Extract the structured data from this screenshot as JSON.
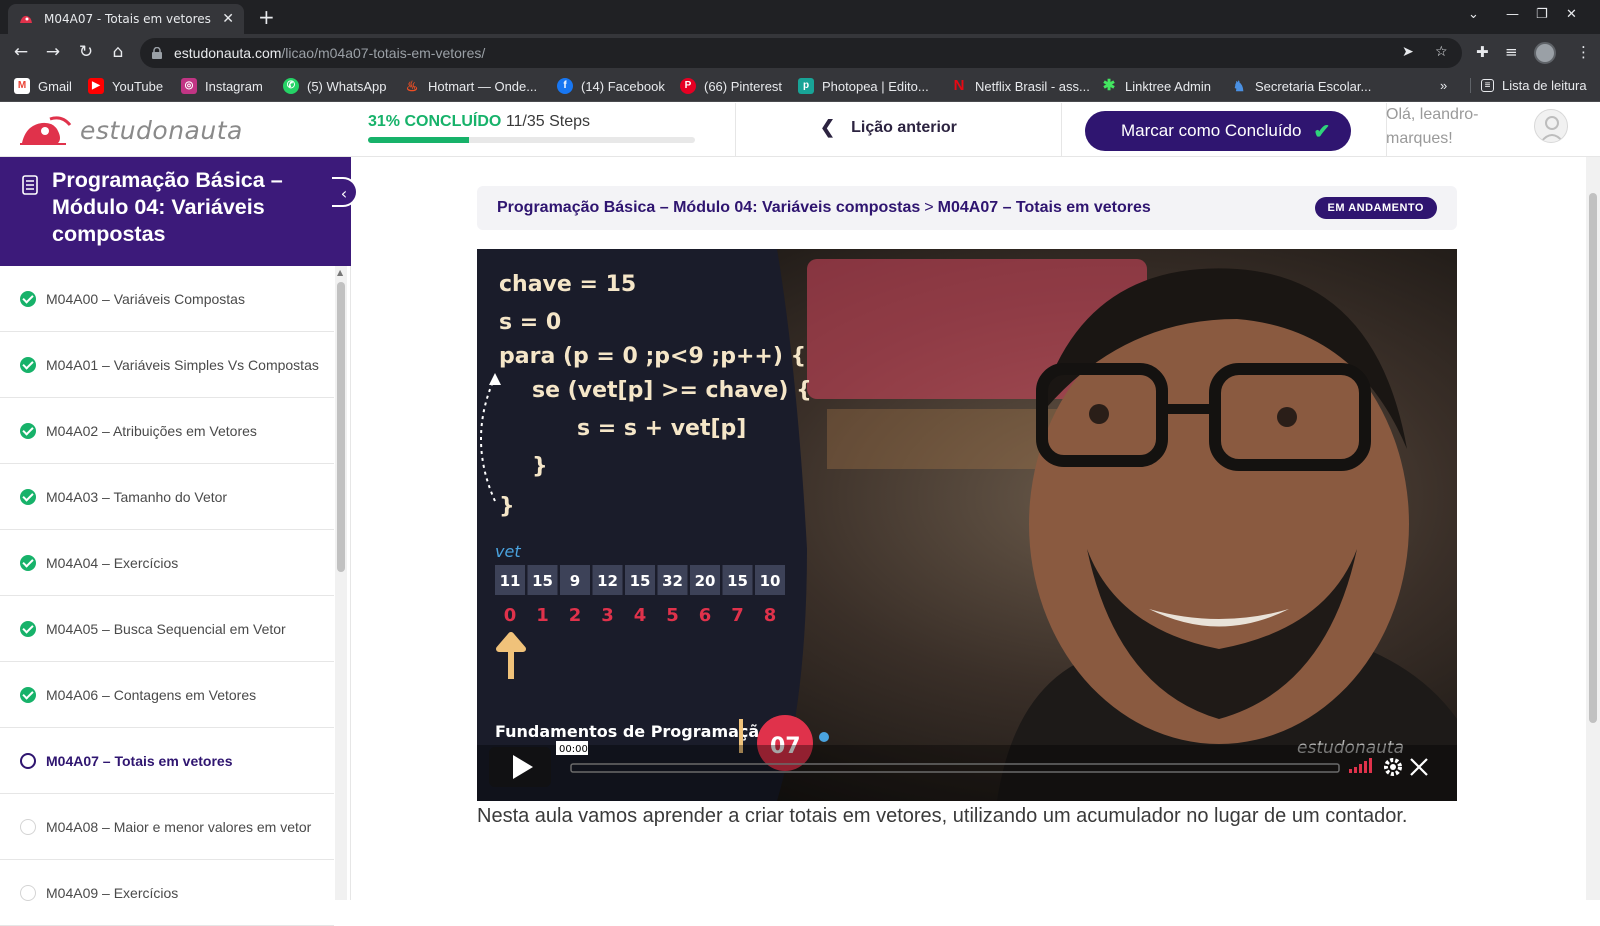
{
  "browser": {
    "tab_title": "M04A07 - Totais em vetores -",
    "url_domain": "estudonauta.com",
    "url_path": "/licao/m04a07-totais-em-vetores/",
    "bookmarks": [
      {
        "label": "Gmail",
        "icon": "gmail-icon",
        "color": "#ea4335"
      },
      {
        "label": "YouTube",
        "icon": "youtube-icon",
        "color": "#ff0000"
      },
      {
        "label": "Instagram",
        "icon": "instagram-icon",
        "color": "#c13584"
      },
      {
        "label": "(5) WhatsApp",
        "icon": "whatsapp-icon",
        "color": "#25d366"
      },
      {
        "label": "Hotmart — Onde...",
        "icon": "hotmart-icon",
        "color": "#f04e23"
      },
      {
        "label": "(14) Facebook",
        "icon": "facebook-icon",
        "color": "#1877f2"
      },
      {
        "label": "(66) Pinterest",
        "icon": "pinterest-icon",
        "color": "#e60023"
      },
      {
        "label": "Photopea | Edito...",
        "icon": "photopea-icon",
        "color": "#18a497"
      },
      {
        "label": "Netflix Brasil - ass...",
        "icon": "netflix-icon",
        "color": "#e50914"
      },
      {
        "label": "Linktree Admin",
        "icon": "linktree-icon",
        "color": "#43e660"
      },
      {
        "label": "Secretaria Escolar...",
        "icon": "secretaria-icon",
        "color": "#4a90e2"
      }
    ],
    "reading_list": "Lista de leitura"
  },
  "header": {
    "logo_text": "estudonauta",
    "progress_percent_label": "31% CONCLUÍDO",
    "progress_steps": "11/35 Steps",
    "progress_fraction": 0.31,
    "prev_lesson": "Lição anterior",
    "mark_complete": "Marcar como Concluído",
    "greeting": "Olá, leandro-marques!"
  },
  "sidebar": {
    "course_title": "Programação Básica – Módulo 04: Variáveis compostas",
    "lessons": [
      {
        "label": "M04A00 – Variáveis Compostas",
        "status": "done"
      },
      {
        "label": "M04A01 – Variáveis Simples Vs Compostas",
        "status": "done"
      },
      {
        "label": "M04A02 – Atribuições em Vetores",
        "status": "done"
      },
      {
        "label": "M04A03 – Tamanho do Vetor",
        "status": "done"
      },
      {
        "label": "M04A04 – Exercícios",
        "status": "done"
      },
      {
        "label": "M04A05 – Busca Sequencial em Vetor",
        "status": "done"
      },
      {
        "label": "M04A06 – Contagens em Vetores",
        "status": "done"
      },
      {
        "label": "M04A07 – Totais em vetores",
        "status": "current"
      },
      {
        "label": "M04A08 – Maior e menor valores em vetor",
        "status": "todo"
      },
      {
        "label": "M04A09 – Exercícios",
        "status": "todo"
      }
    ]
  },
  "main": {
    "breadcrumb_course": "Programação Básica – Módulo 04: Variáveis compostas",
    "breadcrumb_sep": ">",
    "breadcrumb_lesson": "M04A07 – Totais em vetores",
    "status_badge": "EM ANDAMENTO",
    "video": {
      "code_lines": [
        "chave = 15",
        "s = 0",
        "para (p = 0 ;p<9 ;p++) {",
        "se (vet[p] >= chave) {",
        "s = s + vet[p]",
        "}",
        "}"
      ],
      "vector_label": "vet",
      "vector_values": [
        "11",
        "15",
        "9",
        "12",
        "15",
        "32",
        "20",
        "15",
        "10"
      ],
      "vector_indexes": [
        "0",
        "1",
        "2",
        "3",
        "4",
        "5",
        "6",
        "7",
        "8"
      ],
      "series_title": "Fundamentos de Programação",
      "episode_number": "07",
      "brand_watermark": "estudonauta",
      "time": "00:00"
    },
    "description": "Nesta aula vamos aprender a criar totais em vetores, utilizando um acumulador no lugar de um contador."
  }
}
